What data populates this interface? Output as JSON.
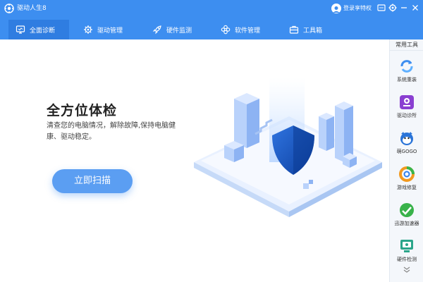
{
  "app": {
    "title": "驱动人生8",
    "brand_color": "#3d8ef0"
  },
  "header": {
    "login_label": "登录享特权",
    "icons": [
      "avatar-icon",
      "message-icon",
      "settings-icon",
      "minimize-icon",
      "close-icon"
    ]
  },
  "tabs": [
    {
      "label": "全面诊断",
      "icon": "monitor-icon",
      "active": true
    },
    {
      "label": "驱动管理",
      "icon": "gear-icon",
      "active": false
    },
    {
      "label": "硬件监测",
      "icon": "rocket-icon",
      "active": false
    },
    {
      "label": "软件管理",
      "icon": "apps-icon",
      "active": false
    },
    {
      "label": "工具箱",
      "icon": "toolbox-icon",
      "active": false
    }
  ],
  "hero": {
    "title": "全方位体检",
    "description": "清查您的电脑情况，解除故障,保持电脑健康、驱动稳定。",
    "scan_button": "立即扫描"
  },
  "sidebar": {
    "heading": "常用工具",
    "items": [
      {
        "label": "系统重装",
        "icon": "system-reinstall-icon"
      },
      {
        "label": "驱动诊所",
        "icon": "driver-clinic-icon"
      },
      {
        "label": "萌GOGO",
        "icon": "cat-mascot-icon"
      },
      {
        "label": "游戏修复",
        "icon": "game-repair-icon"
      },
      {
        "label": "迅游加速器",
        "icon": "accelerator-icon"
      },
      {
        "label": "硬件检测",
        "icon": "hardware-check-icon"
      }
    ],
    "more_icon": "chevron-down-icon"
  }
}
